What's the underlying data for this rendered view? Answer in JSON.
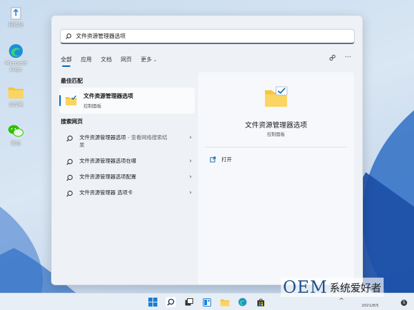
{
  "desktop": {
    "icons": [
      {
        "name": "recycle-bin",
        "label": "回收站"
      },
      {
        "name": "edge",
        "label": "Microsoft Edge"
      },
      {
        "name": "folder",
        "label": "文件夹"
      },
      {
        "name": "wechat",
        "label": "微信"
      }
    ]
  },
  "search": {
    "query": "文件资源管理器选项"
  },
  "tabs": {
    "items": [
      "全部",
      "应用",
      "文档",
      "网页",
      "更多"
    ],
    "active": "全部"
  },
  "best_match": {
    "section_title": "最佳匹配",
    "title": "文件资源管理器选项",
    "subtitle": "控制面板"
  },
  "web_search": {
    "section_title": "搜索网页",
    "items": [
      {
        "text": "文件资源管理器选项",
        "hint": " - 查看网络搜索结果"
      },
      {
        "text": "文件资源管理器选项在哪",
        "hint": ""
      },
      {
        "text": "文件资源管理器选项配置",
        "hint": ""
      },
      {
        "text": "文件资源管理器 选项卡",
        "hint": ""
      }
    ]
  },
  "detail": {
    "title": "文件资源管理器选项",
    "subtitle": "控制面板",
    "action_label": "打开"
  },
  "taskbar": {
    "date": "2021/8/5",
    "badge": "5"
  },
  "watermark": {
    "brand": "OEM",
    "text": "系统爱好者"
  },
  "colors": {
    "accent": "#0063b1",
    "folder": "#f6c443",
    "menu_bg": "#eef2f7"
  }
}
